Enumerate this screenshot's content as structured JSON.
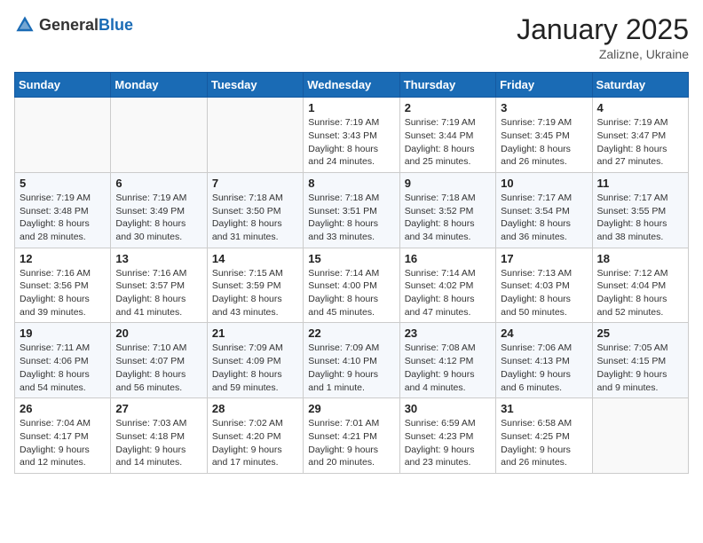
{
  "header": {
    "logo_general": "General",
    "logo_blue": "Blue",
    "month_title": "January 2025",
    "location": "Zalizne, Ukraine"
  },
  "days_of_week": [
    "Sunday",
    "Monday",
    "Tuesday",
    "Wednesday",
    "Thursday",
    "Friday",
    "Saturday"
  ],
  "weeks": [
    [
      {
        "day": "",
        "info": ""
      },
      {
        "day": "",
        "info": ""
      },
      {
        "day": "",
        "info": ""
      },
      {
        "day": "1",
        "info": "Sunrise: 7:19 AM\nSunset: 3:43 PM\nDaylight: 8 hours and 24 minutes."
      },
      {
        "day": "2",
        "info": "Sunrise: 7:19 AM\nSunset: 3:44 PM\nDaylight: 8 hours and 25 minutes."
      },
      {
        "day": "3",
        "info": "Sunrise: 7:19 AM\nSunset: 3:45 PM\nDaylight: 8 hours and 26 minutes."
      },
      {
        "day": "4",
        "info": "Sunrise: 7:19 AM\nSunset: 3:47 PM\nDaylight: 8 hours and 27 minutes."
      }
    ],
    [
      {
        "day": "5",
        "info": "Sunrise: 7:19 AM\nSunset: 3:48 PM\nDaylight: 8 hours and 28 minutes."
      },
      {
        "day": "6",
        "info": "Sunrise: 7:19 AM\nSunset: 3:49 PM\nDaylight: 8 hours and 30 minutes."
      },
      {
        "day": "7",
        "info": "Sunrise: 7:18 AM\nSunset: 3:50 PM\nDaylight: 8 hours and 31 minutes."
      },
      {
        "day": "8",
        "info": "Sunrise: 7:18 AM\nSunset: 3:51 PM\nDaylight: 8 hours and 33 minutes."
      },
      {
        "day": "9",
        "info": "Sunrise: 7:18 AM\nSunset: 3:52 PM\nDaylight: 8 hours and 34 minutes."
      },
      {
        "day": "10",
        "info": "Sunrise: 7:17 AM\nSunset: 3:54 PM\nDaylight: 8 hours and 36 minutes."
      },
      {
        "day": "11",
        "info": "Sunrise: 7:17 AM\nSunset: 3:55 PM\nDaylight: 8 hours and 38 minutes."
      }
    ],
    [
      {
        "day": "12",
        "info": "Sunrise: 7:16 AM\nSunset: 3:56 PM\nDaylight: 8 hours and 39 minutes."
      },
      {
        "day": "13",
        "info": "Sunrise: 7:16 AM\nSunset: 3:57 PM\nDaylight: 8 hours and 41 minutes."
      },
      {
        "day": "14",
        "info": "Sunrise: 7:15 AM\nSunset: 3:59 PM\nDaylight: 8 hours and 43 minutes."
      },
      {
        "day": "15",
        "info": "Sunrise: 7:14 AM\nSunset: 4:00 PM\nDaylight: 8 hours and 45 minutes."
      },
      {
        "day": "16",
        "info": "Sunrise: 7:14 AM\nSunset: 4:02 PM\nDaylight: 8 hours and 47 minutes."
      },
      {
        "day": "17",
        "info": "Sunrise: 7:13 AM\nSunset: 4:03 PM\nDaylight: 8 hours and 50 minutes."
      },
      {
        "day": "18",
        "info": "Sunrise: 7:12 AM\nSunset: 4:04 PM\nDaylight: 8 hours and 52 minutes."
      }
    ],
    [
      {
        "day": "19",
        "info": "Sunrise: 7:11 AM\nSunset: 4:06 PM\nDaylight: 8 hours and 54 minutes."
      },
      {
        "day": "20",
        "info": "Sunrise: 7:10 AM\nSunset: 4:07 PM\nDaylight: 8 hours and 56 minutes."
      },
      {
        "day": "21",
        "info": "Sunrise: 7:09 AM\nSunset: 4:09 PM\nDaylight: 8 hours and 59 minutes."
      },
      {
        "day": "22",
        "info": "Sunrise: 7:09 AM\nSunset: 4:10 PM\nDaylight: 9 hours and 1 minute."
      },
      {
        "day": "23",
        "info": "Sunrise: 7:08 AM\nSunset: 4:12 PM\nDaylight: 9 hours and 4 minutes."
      },
      {
        "day": "24",
        "info": "Sunrise: 7:06 AM\nSunset: 4:13 PM\nDaylight: 9 hours and 6 minutes."
      },
      {
        "day": "25",
        "info": "Sunrise: 7:05 AM\nSunset: 4:15 PM\nDaylight: 9 hours and 9 minutes."
      }
    ],
    [
      {
        "day": "26",
        "info": "Sunrise: 7:04 AM\nSunset: 4:17 PM\nDaylight: 9 hours and 12 minutes."
      },
      {
        "day": "27",
        "info": "Sunrise: 7:03 AM\nSunset: 4:18 PM\nDaylight: 9 hours and 14 minutes."
      },
      {
        "day": "28",
        "info": "Sunrise: 7:02 AM\nSunset: 4:20 PM\nDaylight: 9 hours and 17 minutes."
      },
      {
        "day": "29",
        "info": "Sunrise: 7:01 AM\nSunset: 4:21 PM\nDaylight: 9 hours and 20 minutes."
      },
      {
        "day": "30",
        "info": "Sunrise: 6:59 AM\nSunset: 4:23 PM\nDaylight: 9 hours and 23 minutes."
      },
      {
        "day": "31",
        "info": "Sunrise: 6:58 AM\nSunset: 4:25 PM\nDaylight: 9 hours and 26 minutes."
      },
      {
        "day": "",
        "info": ""
      }
    ]
  ]
}
